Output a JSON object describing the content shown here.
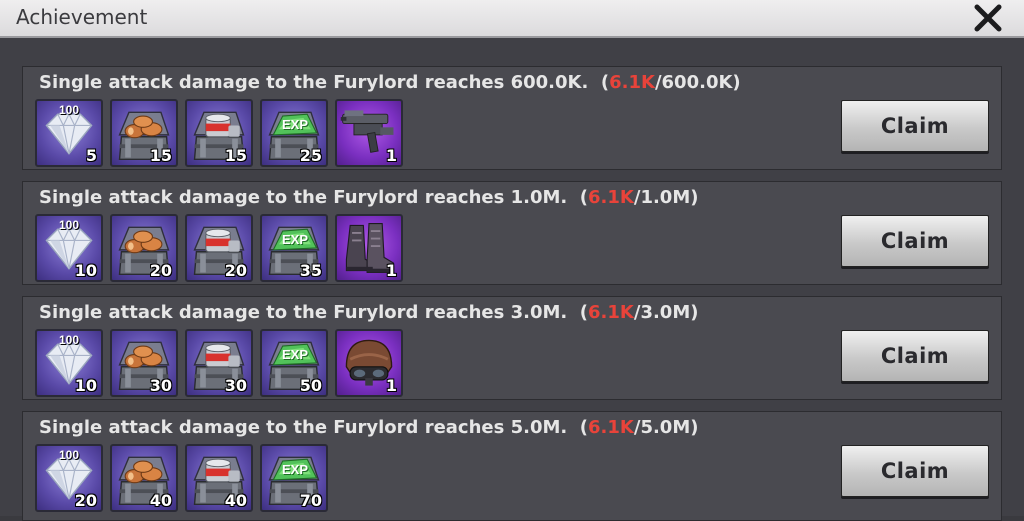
{
  "window": {
    "title": "Achievement"
  },
  "colors": {
    "progress_current": "#e8433a",
    "item_blue": "#6a5bc0",
    "item_purple": "#8a35d0"
  },
  "achievements": [
    {
      "text": "Single attack damage to the Furylord reaches 600.0K.",
      "open": "(",
      "current": "6.1K",
      "target": "/600.0K)",
      "claim": "Claim",
      "rewards": [
        {
          "icon": "diamond-icon",
          "label": "100",
          "qty": "5"
        },
        {
          "icon": "wood-crate-icon",
          "qty": "15"
        },
        {
          "icon": "food-crate-icon",
          "qty": "15"
        },
        {
          "icon": "exp-crate-icon",
          "qty": "25"
        },
        {
          "icon": "rifle-icon",
          "qty": "1"
        }
      ]
    },
    {
      "text": "Single attack damage to the Furylord reaches 1.0M.",
      "open": "(",
      "current": "6.1K",
      "target": "/1.0M)",
      "claim": "Claim",
      "rewards": [
        {
          "icon": "diamond-icon",
          "label": "100",
          "qty": "10"
        },
        {
          "icon": "wood-crate-icon",
          "qty": "20"
        },
        {
          "icon": "food-crate-icon",
          "qty": "20"
        },
        {
          "icon": "exp-crate-icon",
          "qty": "35"
        },
        {
          "icon": "boots-icon",
          "qty": "1"
        }
      ]
    },
    {
      "text": "Single attack damage to the Furylord reaches 3.0M.",
      "open": "(",
      "current": "6.1K",
      "target": "/3.0M)",
      "claim": "Claim",
      "rewards": [
        {
          "icon": "diamond-icon",
          "label": "100",
          "qty": "10"
        },
        {
          "icon": "wood-crate-icon",
          "qty": "30"
        },
        {
          "icon": "food-crate-icon",
          "qty": "30"
        },
        {
          "icon": "exp-crate-icon",
          "qty": "50"
        },
        {
          "icon": "helmet-icon",
          "qty": "1"
        }
      ]
    },
    {
      "text": "Single attack damage to the Furylord reaches 5.0M.",
      "open": "(",
      "current": "6.1K",
      "target": "/5.0M)",
      "claim": "Claim",
      "rewards": [
        {
          "icon": "diamond-icon",
          "label": "100",
          "qty": "20"
        },
        {
          "icon": "wood-crate-icon",
          "qty": "40"
        },
        {
          "icon": "food-crate-icon",
          "qty": "40"
        },
        {
          "icon": "exp-crate-icon",
          "qty": "70"
        }
      ]
    }
  ],
  "exp_label": "EXP"
}
